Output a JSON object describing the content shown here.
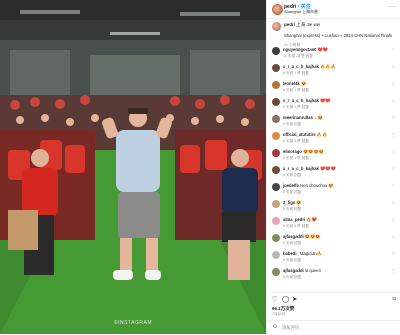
{
  "post": {
    "username": "pedri",
    "follow_label": "关注",
    "location": "Shanghai 上海市香",
    "more_label": "···"
  },
  "media": {
    "watermark": "©INSTAGRAM"
  },
  "caption": {
    "username": "pedri",
    "text": "上海 Jie wei",
    "body": "Shanghai (express) + Lushan + 2024 CHN National Finals",
    "time": "11 小时前"
  },
  "comments": [
    {
      "user": "nguyenngoctan0",
      "text": "❤️❤️",
      "meta": "10 天前   28 赞   回复",
      "color": "#3c3c3c"
    },
    {
      "user": "x_r_a_c_h_kajhak",
      "text": "🔥🔥🔥",
      "meta": "6 天前   1 赞   回复",
      "color": "#6d4b3a"
    },
    {
      "user": "leonel4k",
      "text": "😍",
      "meta": "6 天前   1 赞   回复",
      "color": "#b0743f"
    },
    {
      "user": "x_r_a_c_h_kajhak",
      "text": "❤️❤️",
      "meta": "6 天前   1 赞   回复",
      "color": "#6d4b3a"
    },
    {
      "user": "meerinanrullas",
      "text": "...😍",
      "meta": "6 天前   回复",
      "color": "#8d6e63"
    },
    {
      "user": "official_atututirs",
      "text": "🔥🔥",
      "meta": "6 天前   1 赞   回复",
      "color": "#d88c42"
    },
    {
      "user": "elmorago",
      "text": "😍😍😍😍",
      "meta": "6 天前   1 赞   回复",
      "color": "#a23c3c"
    },
    {
      "user": "x_r_a_c_h_kajhak",
      "text": "❤️❤️❤️",
      "meta": "6 天前   回复",
      "color": "#6d4b3a"
    },
    {
      "user": "joedelfo",
      "text": "Hen chouchou 😍",
      "meta": "6 天前   回复",
      "color": "#444444"
    },
    {
      "user": "2_figs",
      "text": "😍",
      "meta": "6 天前   回复",
      "color": "#c9a57a"
    },
    {
      "user": "alma_pedri",
      "text": "🔥❤️",
      "meta": "6 天前   3 赞   回复",
      "color": "#e7a4b5"
    },
    {
      "user": "ajfasgaddi",
      "text": "😍😍😍",
      "meta": "6 天前   回复",
      "color": "#7e8f59"
    },
    {
      "user": "babedi_",
      "text": "Magician🔥",
      "meta": "6 天前   回复",
      "color": "#b9b9b9"
    },
    {
      "user": "ajfasgaddi",
      "text": "la queen",
      "meta": "6 天前   回复",
      "color": "#7e8f59"
    }
  ],
  "stats": {
    "likes": "66.1万次赞",
    "date": "7月30日"
  },
  "add_comment": {
    "placeholder": "添加评论..."
  },
  "icons": {
    "like": "heart-icon",
    "comment": "comment-icon",
    "share": "share-icon",
    "save": "bookmark-icon",
    "emoji": "emoji-icon"
  }
}
